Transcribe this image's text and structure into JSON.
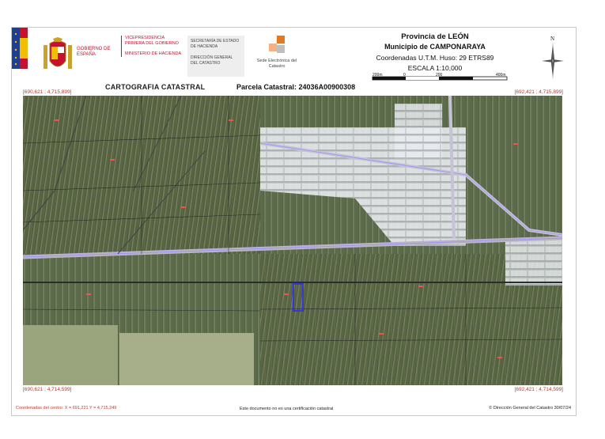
{
  "header": {
    "gov_label": "GOBIERNO DE ESPAÑA",
    "vp_label": "VICEPRESIDENCIA PRIMERA DEL GOBIERNO",
    "ministry_label": "MINISTERIO DE HACIENDA",
    "secretaria_label": "SECRETARÍA DE ESTADO DE HACIENDA",
    "direccion_label": "DIRECCIÓN GENERAL DEL CATASTRO",
    "sede_label": "Sede Electrónica del Catastro",
    "provincia": "Provincia de LEÓN",
    "municipio": "Municipio de CAMPONARAYA",
    "coordenadas": "Coordenadas U.T.M. Huso: 29 ETRS89",
    "escala": "ESCALA 1:10,000",
    "scale_ticks": [
      "200m",
      "0",
      "200",
      "400m"
    ],
    "north_letter": "N"
  },
  "title": {
    "cartografia": "CARTOGRAFIA CATASTRAL",
    "parcela": "Parcela Catastral: 24036A00900308"
  },
  "corners": {
    "top_left": "[690,621 ; 4,715,899]",
    "top_right": "[692,421 ; 4,715,899]",
    "bottom_left": "[690,621 ; 4,714,599]",
    "bottom_right": "[692,421 ; 4,714,599]"
  },
  "footer": {
    "centro": "Coordenadas del centro: X = 691,221 Y = 4,715,249",
    "aviso": "Este documento no es una certificación catastral",
    "copyright": "© Dirección General del Catastro 30/07/24"
  },
  "colors": {
    "red_accent": "#c8102e",
    "parcel_highlight": "#2b2bff",
    "parcel_lines": "#ff4d4d",
    "road_outline": "#9b8cff"
  }
}
